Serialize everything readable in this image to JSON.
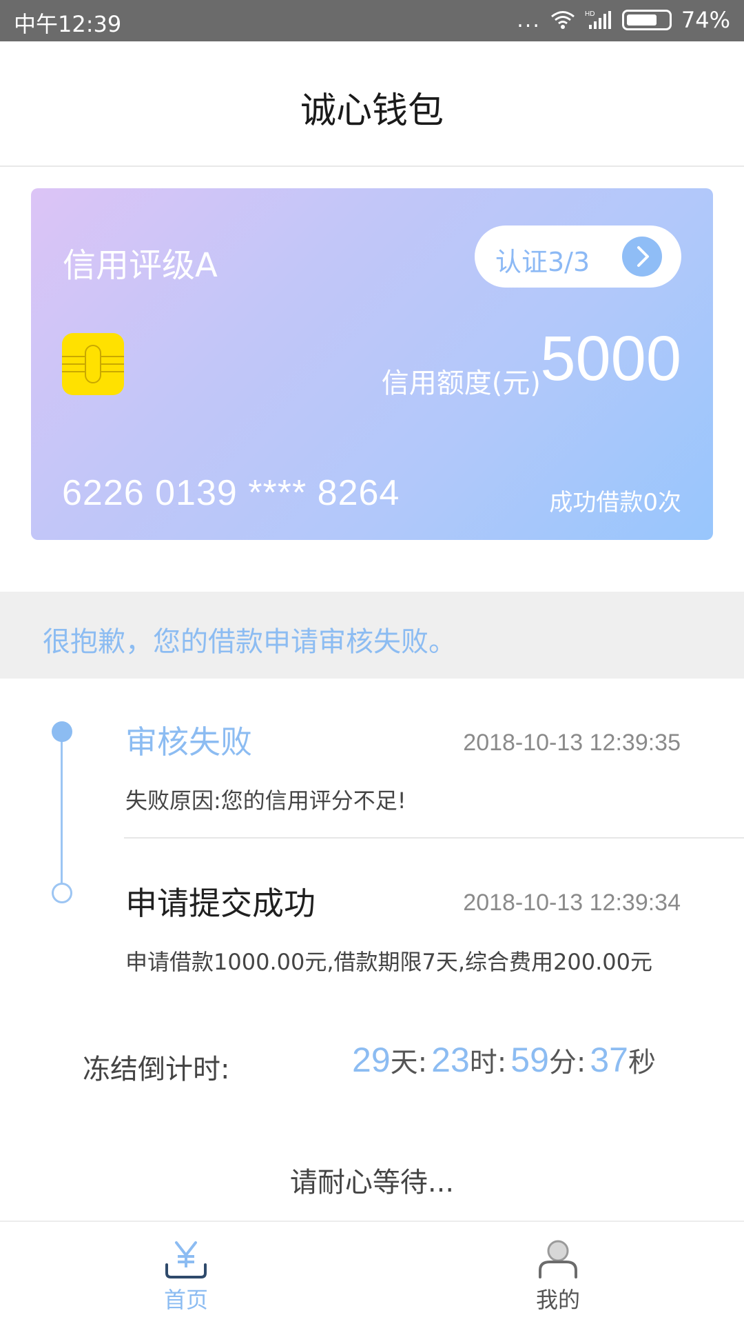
{
  "status_bar": {
    "time": "中午12:39",
    "signal_dots": "...",
    "network": "HD",
    "battery": "74%",
    "battery_level": 0.74
  },
  "header": {
    "title": "诚心钱包"
  },
  "card": {
    "rating": "信用评级A",
    "auth_label": "认证3/3",
    "limit_label": "信用额度(元)",
    "limit_value": "5000",
    "card_number": "6226 0139 **** 8264",
    "loans": "成功借款0次",
    "chip_color": "#FFE100"
  },
  "notice": {
    "text": "很抱歉，您的借款申请审核失败。"
  },
  "timeline": [
    {
      "title": "审核失败",
      "time": "2018-10-13 12:39:35",
      "desc": "失败原因:您的信用评分不足!"
    },
    {
      "title": "申请提交成功",
      "time": "2018-10-13 12:39:34",
      "desc": "申请借款1000.00元,借款期限7天,综合费用200.00元"
    }
  ],
  "countdown": {
    "label": "冻结倒计时:",
    "days": "29",
    "days_unit": "天:",
    "hours": "23",
    "hours_unit": "时:",
    "minutes": "59",
    "minutes_unit": "分:",
    "seconds": "37",
    "seconds_unit": "秒"
  },
  "waiting": "请耐心等待...",
  "tabbar": {
    "home_label": "首页",
    "mine_label": "我的"
  },
  "colors": {
    "accent": "#8CBCF2",
    "notice_bg": "#EFEFEF"
  }
}
